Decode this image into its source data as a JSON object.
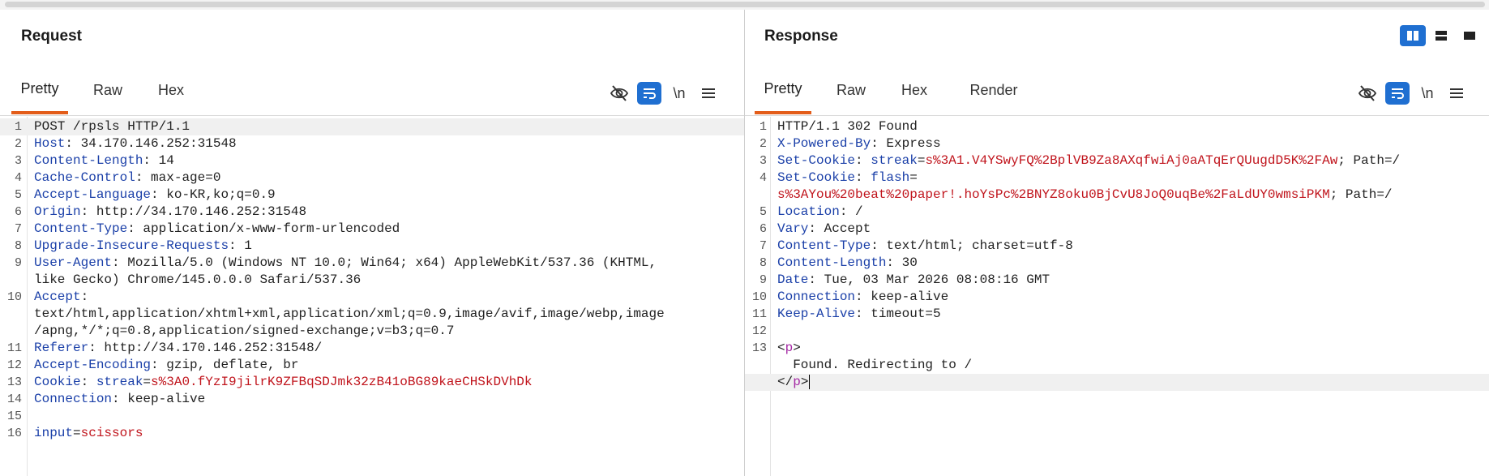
{
  "request": {
    "title": "Request",
    "tabs": [
      "Pretty",
      "Raw",
      "Hex"
    ],
    "active_tab": "Pretty",
    "tools": {
      "hide_icon": "eye-slash-icon",
      "wrap_icon": "wrap-lines-icon",
      "newline_label": "\\n",
      "menu_icon": "hamburger-icon"
    },
    "lines": [
      {
        "n": "1",
        "key": "POST /rpsls HTTP/1.1",
        "sep": "",
        "val": ""
      },
      {
        "n": "2",
        "key": "Host",
        "sep": ": ",
        "val": "34.170.146.252:31548"
      },
      {
        "n": "3",
        "key": "Content-Length",
        "sep": ": ",
        "val": "14"
      },
      {
        "n": "4",
        "key": "Cache-Control",
        "sep": ": ",
        "val": "max-age=0"
      },
      {
        "n": "5",
        "key": "Accept-Language",
        "sep": ": ",
        "val": "ko-KR,ko;q=0.9"
      },
      {
        "n": "6",
        "key": "Origin",
        "sep": ": ",
        "val": "http://34.170.146.252:31548"
      },
      {
        "n": "7",
        "key": "Content-Type",
        "sep": ": ",
        "val": "application/x-www-form-urlencoded"
      },
      {
        "n": "8",
        "key": "Upgrade-Insecure-Requests",
        "sep": ": ",
        "val": "1"
      },
      {
        "n": "9",
        "key": "User-Agent",
        "sep": ": ",
        "val": "Mozilla/5.0 (Windows NT 10.0; Win64; x64) AppleWebKit/537.36 (KHTML,"
      },
      {
        "n": "",
        "key": "",
        "sep": "",
        "val": "like Gecko) Chrome/145.0.0.0 Safari/537.36"
      },
      {
        "n": "10",
        "key": "Accept",
        "sep": ":",
        "val": ""
      },
      {
        "n": "",
        "key": "",
        "sep": "",
        "val": "text/html,application/xhtml+xml,application/xml;q=0.9,image/avif,image/webp,image"
      },
      {
        "n": "",
        "key": "",
        "sep": "",
        "val": "/apng,*/*;q=0.8,application/signed-exchange;v=b3;q=0.7"
      },
      {
        "n": "11",
        "key": "Referer",
        "sep": ": ",
        "val": "http://34.170.146.252:31548/"
      },
      {
        "n": "12",
        "key": "Accept-Encoding",
        "sep": ": ",
        "val": "gzip, deflate, br"
      },
      {
        "n": "13",
        "key": "Cookie",
        "sep": ": ",
        "val": ""
      },
      {
        "n": "14",
        "key": "Connection",
        "sep": ": ",
        "val": "keep-alive"
      },
      {
        "n": "15",
        "key": "",
        "sep": "",
        "val": ""
      },
      {
        "n": "16",
        "key": "",
        "sep": "",
        "val": ""
      }
    ],
    "cookie": {
      "name": "streak",
      "eq": "=",
      "value": "s%3A0.fYzI9jilrK9ZFBqSDJmk32zB41oBG89kaeCHSkDVhDk"
    },
    "body": {
      "name": "input",
      "eq": "=",
      "value": "scissors"
    }
  },
  "response": {
    "title": "Response",
    "tabs": [
      "Pretty",
      "Raw",
      "Hex",
      "Render"
    ],
    "active_tab": "Pretty",
    "layout_icons": [
      "split-vertical-icon",
      "split-horizontal-icon",
      "single-pane-icon"
    ],
    "tools": {
      "hide_icon": "eye-slash-icon",
      "wrap_icon": "wrap-lines-icon",
      "newline_label": "\\n",
      "menu_icon": "hamburger-icon"
    },
    "status_line": "HTTP/1.1 302 Found",
    "headers": [
      {
        "n": "2",
        "key": "X-Powered-By",
        "val": "Express"
      },
      {
        "n": "5",
        "key": "Location",
        "val": "/"
      },
      {
        "n": "6",
        "key": "Vary",
        "val": "Accept"
      },
      {
        "n": "7",
        "key": "Content-Type",
        "val": "text/html; charset=utf-8"
      },
      {
        "n": "8",
        "key": "Content-Length",
        "val": "30"
      },
      {
        "n": "9",
        "key": "Date",
        "val": "Tue, 03 Mar 2026 08:08:16 GMT"
      },
      {
        "n": "10",
        "key": "Connection",
        "val": "keep-alive"
      },
      {
        "n": "11",
        "key": "Keep-Alive",
        "val": "timeout=5"
      }
    ],
    "set_cookie_1": {
      "n": "3",
      "key": "Set-Cookie",
      "name": "streak",
      "value": "s%3A1.V4YSwyFQ%2BplVB9Za8AXqfwiAj0aATqErQUugdD5K%2FAw",
      "tail": "; Path=/"
    },
    "set_cookie_2": {
      "n": "4",
      "key": "Set-Cookie",
      "name": "flash",
      "value": "s%3AYou%20beat%20paper!.hoYsPc%2BNYZ8oku0BjCvU8JoQ0uqBe%2FaLdUY0wmsiPKM",
      "tail": "; Path=/"
    },
    "body": {
      "open_tag": "p",
      "text": "Found. Redirecting to /",
      "close_tag": "p"
    },
    "line_numbers": [
      "1",
      "2",
      "3",
      "4",
      "",
      "5",
      "6",
      "7",
      "8",
      "9",
      "10",
      "11",
      "12",
      "13",
      "",
      ""
    ]
  }
}
